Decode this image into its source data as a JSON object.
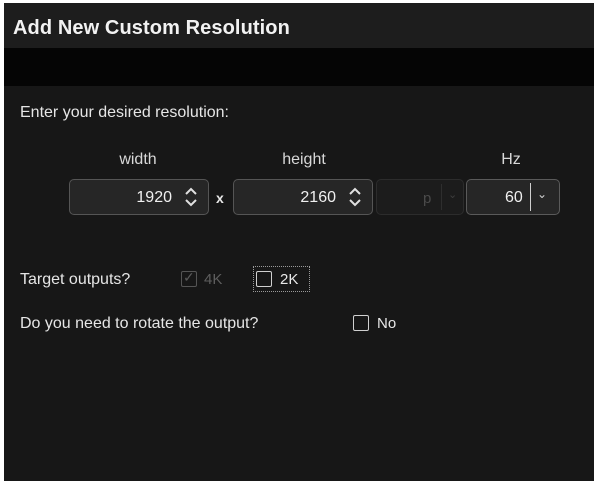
{
  "dialog": {
    "title": "Add New Custom Resolution",
    "prompt": "Enter your desired resolution:"
  },
  "resolution": {
    "width_label": "width",
    "height_label": "height",
    "hz_label": "Hz",
    "width_value": "1920",
    "height_value": "2160",
    "separator": "x",
    "scan_mode": "p",
    "refresh_rate": "60"
  },
  "outputs": {
    "label": "Target outputs?",
    "options": [
      {
        "label": "4K",
        "checked": true,
        "enabled": false
      },
      {
        "label": "2K",
        "checked": false,
        "enabled": true
      }
    ]
  },
  "rotate": {
    "label": "Do you need to rotate the output?",
    "option_label": "No",
    "checked": false
  },
  "icons": [
    "spin-up-down-icon",
    "chevron-down-icon",
    "check-icon"
  ],
  "colors": {
    "background": "#171717",
    "title_bar": "#1d1d1d",
    "field": "#262626"
  }
}
